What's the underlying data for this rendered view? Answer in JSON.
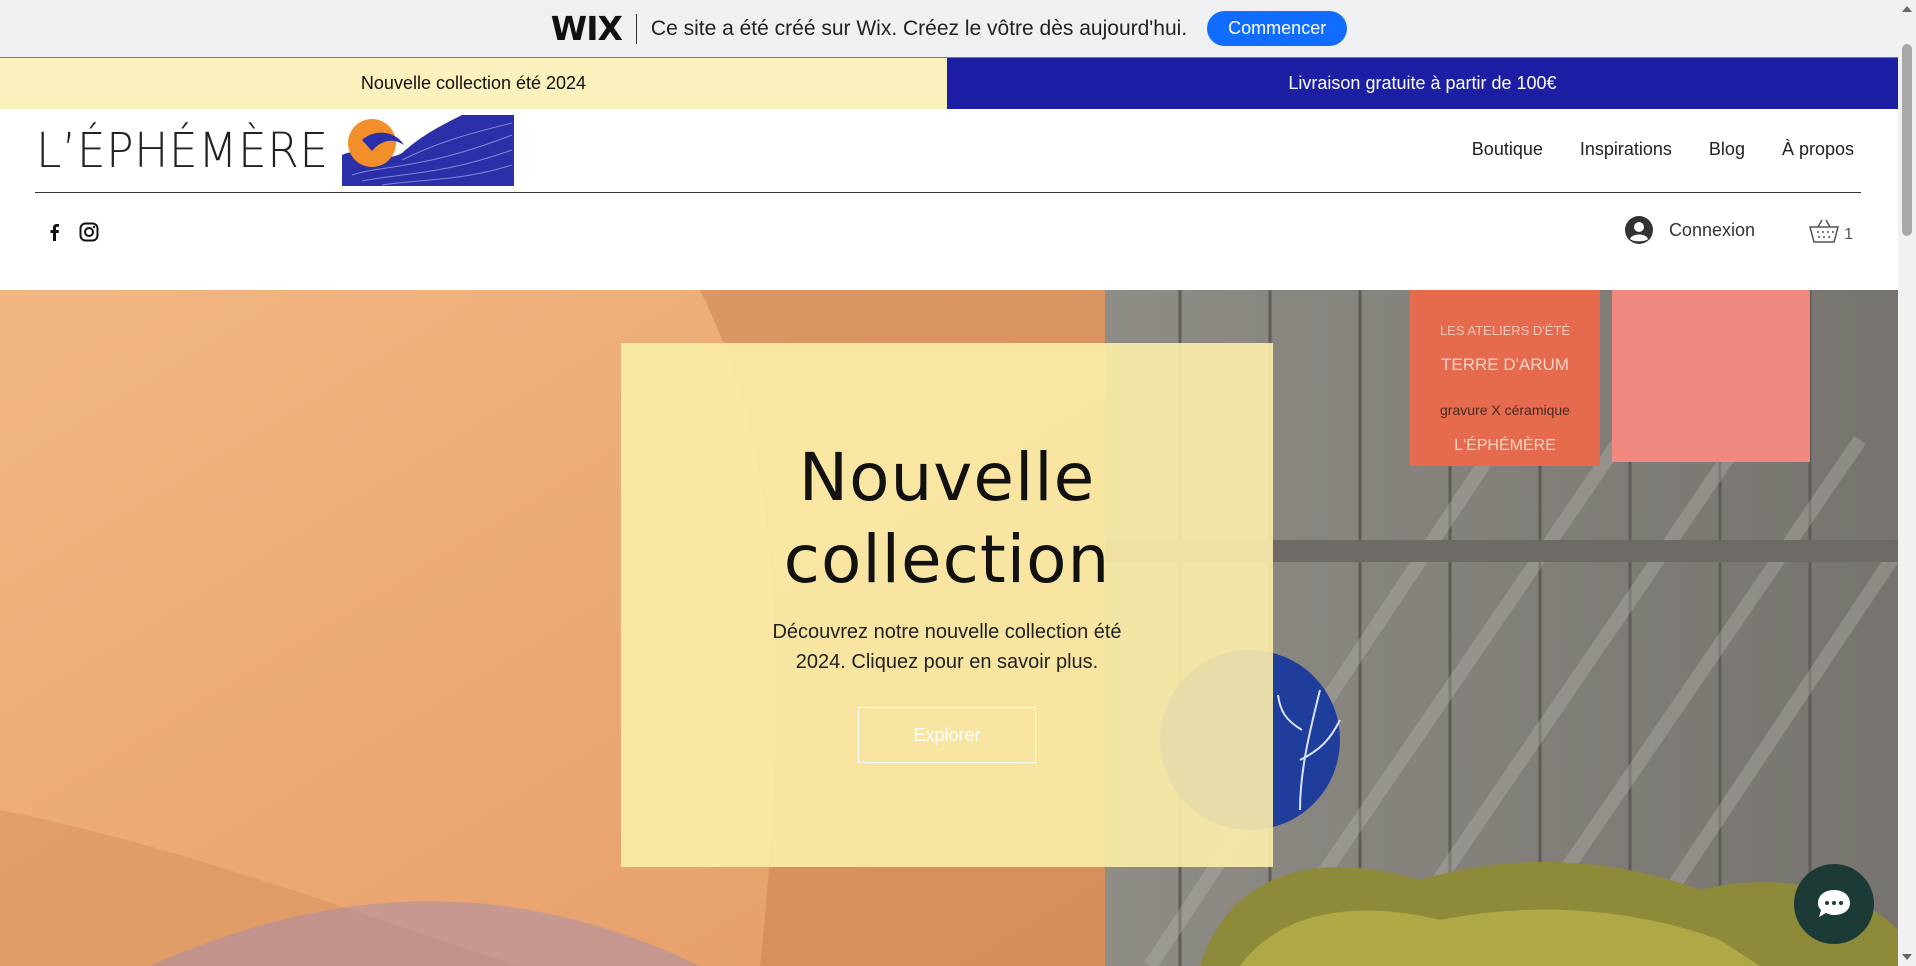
{
  "wix_banner": {
    "logo": "WIX",
    "message": "Ce site a été créé sur Wix. Créez le vôtre dès aujourd'hui.",
    "cta": "Commencer"
  },
  "promo": {
    "left": "Nouvelle collection été 2024",
    "right": "Livraison gratuite à partir de 100€"
  },
  "header": {
    "logo_text": "L’ÉPHÉMÈRE",
    "nav": [
      "Boutique",
      "Inspirations",
      "Blog",
      "À propos"
    ],
    "login_label": "Connexion",
    "cart_count": "1",
    "social_icons": [
      "facebook-icon",
      "instagram-icon"
    ]
  },
  "hero": {
    "title_line1": "Nouvelle",
    "title_line2": "collection",
    "subtitle": "Découvrez notre nouvelle collection été 2024. Cliquez pour en savoir plus.",
    "cta": "Explorer",
    "poster_texts": [
      "LES ATELIERS D'ÉTÉ",
      "TERRE D'ARUM",
      "gravure X céramique",
      "L'ÉPHÉMÈRE"
    ]
  },
  "colors": {
    "wix_button": "#116dff",
    "promo_left": "#fbf1bd",
    "promo_right": "#1c1ea3",
    "hero_card": "#fceeaa",
    "chat_button": "#1d3b36"
  }
}
